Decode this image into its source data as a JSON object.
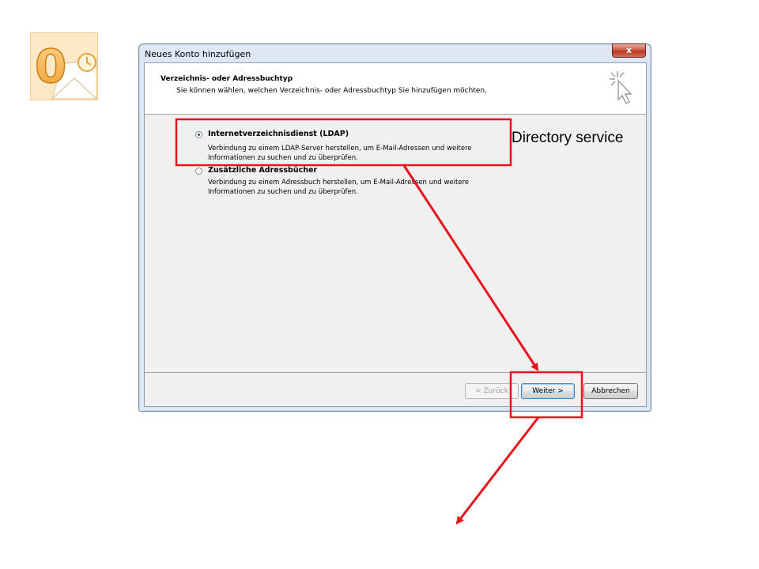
{
  "window": {
    "title": "Neues Konto hinzufügen",
    "close_label": "x"
  },
  "header": {
    "title": "Verzeichnis- oder Adressbuchtyp",
    "subtitle": "Sie können wählen, welchen Verzeichnis- oder Adressbuchtyp Sie hinzufügen möchten."
  },
  "options": [
    {
      "label": "Internetverzeichnisdienst (LDAP)",
      "description": "Verbindung zu einem LDAP-Server herstellen, um E-Mail-Adressen und weitere Informationen zu suchen und zu überprüfen.",
      "selected": true
    },
    {
      "label": "Zusätzliche Adressbücher",
      "description": "Verbindung zu einem Adressbuch herstellen, um E-Mail-Adressen und weitere Informationen zu suchen und zu überprüfen.",
      "selected": false
    }
  ],
  "buttons": {
    "back": "< Zurück",
    "next": "Weiter >",
    "cancel": "Abbrechen"
  },
  "annotation": {
    "label": "Directory service",
    "color": "#e8141b"
  },
  "logo_icon": "outlook-icon"
}
